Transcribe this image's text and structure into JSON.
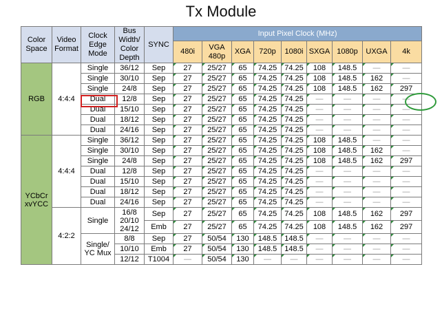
{
  "title": "Tx Module",
  "headers": {
    "color_space": "Color Space",
    "video_format": "Video Format",
    "clock_edge_mode": "Clock Edge Mode",
    "bus_width": "Bus Width/ Color Depth",
    "sync": "SYNC",
    "input_pixel_clock": "Input Pixel Clock (MHz)",
    "pixel_columns": [
      "480i",
      "VGA 480p",
      "XGA",
      "720p",
      "1080i",
      "SXGA",
      "1080p",
      "UXGA",
      "4k"
    ]
  },
  "dash": "—",
  "groups": {
    "rgb": "RGB",
    "ycbcr": "YCbCr xvYCC",
    "f444": "4:4:4",
    "f422": "4:2:2"
  },
  "rows": [
    {
      "mode": "Single",
      "depth": "36/12",
      "sync": "Sep",
      "v": [
        "27",
        "25/27",
        "65",
        "74.25",
        "74.25",
        "108",
        "148.5",
        "—",
        "—"
      ]
    },
    {
      "mode": "Single",
      "depth": "30/10",
      "sync": "Sep",
      "v": [
        "27",
        "25/27",
        "65",
        "74.25",
        "74.25",
        "108",
        "148.5",
        "162",
        "—"
      ]
    },
    {
      "mode": "Single",
      "depth": "24/8",
      "sync": "Sep",
      "v": [
        "27",
        "25/27",
        "65",
        "74.25",
        "74.25",
        "108",
        "148.5",
        "162",
        "297"
      ]
    },
    {
      "mode": "Dual",
      "depth": "12/8",
      "sync": "Sep",
      "v": [
        "27",
        "25/27",
        "65",
        "74.25",
        "74.25",
        "—",
        "—",
        "—",
        "—"
      ]
    },
    {
      "mode": "Dual",
      "depth": "15/10",
      "sync": "Sep",
      "v": [
        "27",
        "25/27",
        "65",
        "74.25",
        "74.25",
        "—",
        "—",
        "—",
        "—"
      ]
    },
    {
      "mode": "Dual",
      "depth": "18/12",
      "sync": "Sep",
      "v": [
        "27",
        "25/27",
        "65",
        "74.25",
        "74.25",
        "—",
        "—",
        "—",
        "—"
      ]
    },
    {
      "mode": "Dual",
      "depth": "24/16",
      "sync": "Sep",
      "v": [
        "27",
        "25/27",
        "65",
        "74.25",
        "74.25",
        "—",
        "—",
        "—",
        "—"
      ]
    },
    {
      "mode": "Single",
      "depth": "36/12",
      "sync": "Sep",
      "v": [
        "27",
        "25/27",
        "65",
        "74.25",
        "74.25",
        "108",
        "148.5",
        "—",
        "—"
      ]
    },
    {
      "mode": "Single",
      "depth": "30/10",
      "sync": "Sep",
      "v": [
        "27",
        "25/27",
        "65",
        "74.25",
        "74.25",
        "108",
        "148.5",
        "162",
        "—"
      ]
    },
    {
      "mode": "Single",
      "depth": "24/8",
      "sync": "Sep",
      "v": [
        "27",
        "25/27",
        "65",
        "74.25",
        "74.25",
        "108",
        "148.5",
        "162",
        "297"
      ]
    },
    {
      "mode": "Dual",
      "depth": "12/8",
      "sync": "Sep",
      "v": [
        "27",
        "25/27",
        "65",
        "74.25",
        "74.25",
        "—",
        "—",
        "—",
        "—"
      ]
    },
    {
      "mode": "Dual",
      "depth": "15/10",
      "sync": "Sep",
      "v": [
        "27",
        "25/27",
        "65",
        "74.25",
        "74.25",
        "—",
        "—",
        "—",
        "—"
      ]
    },
    {
      "mode": "Dual",
      "depth": "18/12",
      "sync": "Sep",
      "v": [
        "27",
        "25/27",
        "65",
        "74.25",
        "74.25",
        "—",
        "—",
        "—",
        "—"
      ]
    },
    {
      "mode": "Dual",
      "depth": "24/16",
      "sync": "Sep",
      "v": [
        "27",
        "25/27",
        "65",
        "74.25",
        "74.25",
        "—",
        "—",
        "—",
        "—"
      ]
    }
  ],
  "yc422": {
    "single_mode": "Single",
    "mux_mode": "Single/ YC Mux",
    "single_depth": "16/8 20/10 24/12",
    "single_rows": [
      {
        "sync": "Sep",
        "v": [
          "27",
          "25/27",
          "65",
          "74.25",
          "74.25",
          "108",
          "148.5",
          "162",
          "297"
        ]
      },
      {
        "sync": "Emb",
        "v": [
          "27",
          "25/27",
          "65",
          "74.25",
          "74.25",
          "108",
          "148.5",
          "162",
          "297"
        ]
      }
    ],
    "mux_rows": [
      {
        "depth": "8/8",
        "sync": "Sep",
        "v": [
          "27",
          "50/54",
          "130",
          "148.5",
          "148.5",
          "—",
          "—",
          "—",
          "—"
        ]
      },
      {
        "depth": "10/10",
        "sync": "Emb",
        "v": [
          "27",
          "50/54",
          "130",
          "148.5",
          "148.5",
          "—",
          "—",
          "—",
          "—"
        ]
      },
      {
        "depth": "12/12",
        "sync": "T1004",
        "v": [
          "—",
          "50/54",
          "130",
          "—",
          "—",
          "—",
          "—",
          "—",
          "—"
        ]
      }
    ]
  }
}
